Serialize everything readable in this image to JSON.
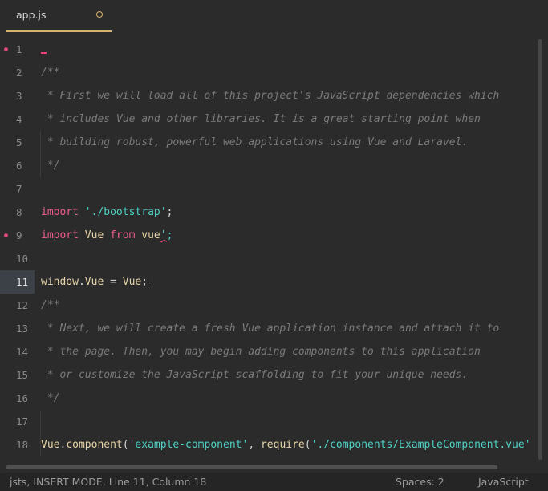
{
  "tab": {
    "label": "app.js",
    "modified": true
  },
  "editor": {
    "active_line": 11,
    "lines": [
      {
        "num": "1"
      },
      {
        "num": "2",
        "text": "/**"
      },
      {
        "num": "3",
        "text": " * First we will load all of this project's JavaScript dependencies which"
      },
      {
        "num": "4",
        "text": " * includes Vue and other libraries. It is a great starting point when"
      },
      {
        "num": "5",
        "text": " * building robust, powerful web applications using Vue and Laravel."
      },
      {
        "num": "6",
        "text": " */"
      },
      {
        "num": "7"
      },
      {
        "num": "8",
        "kw": "import",
        "str": "'./bootstrap'",
        "end": ";"
      },
      {
        "num": "9",
        "kw": "import",
        "id1": "Vue",
        "kw2": "from",
        "id2": "vue",
        "bad": "'",
        "end": ";"
      },
      {
        "num": "10"
      },
      {
        "num": "11",
        "obj": "window",
        "prop": "Vue",
        "op": " = ",
        "val": "Vue",
        "end": ";"
      },
      {
        "num": "12",
        "text": "/**"
      },
      {
        "num": "13",
        "text": " * Next, we will create a fresh Vue application instance and attach it to"
      },
      {
        "num": "14",
        "text": " * the page. Then, you may begin adding components to this application"
      },
      {
        "num": "15",
        "text": " * or customize the JavaScript scaffolding to fit your unique needs."
      },
      {
        "num": "16",
        "text": " */"
      },
      {
        "num": "17"
      },
      {
        "num": "18",
        "obj": "Vue",
        "method": "component",
        "open": "(",
        "arg1": "'example-component'",
        "comma": ", ",
        "fn": "require",
        "open2": "(",
        "arg2": "'./components/ExampleComponent.vue'"
      }
    ]
  },
  "status": {
    "left": "jsts, INSERT MODE, Line 11, Column 18",
    "spaces": "Spaces: 2",
    "language": "JavaScript"
  },
  "colors": {
    "keyword": "#ef5f8f",
    "string": "#4fd1c5",
    "comment": "#7a7a7a",
    "accent": "#d9b26d",
    "error_marker": "#e0467a"
  }
}
